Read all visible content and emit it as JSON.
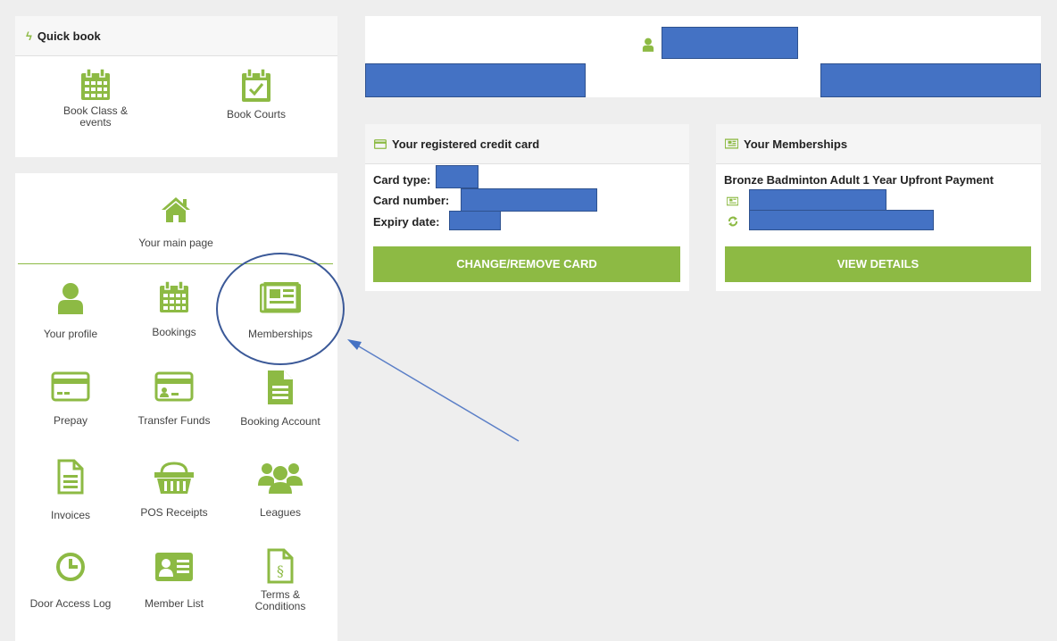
{
  "colors": {
    "accent": "#8dba44",
    "redaction": "#4472c4",
    "annotation": "#3b5998"
  },
  "quick_book": {
    "title": "Quick book",
    "items": [
      {
        "label": "Book Class & events",
        "icon": "calendar-icon"
      },
      {
        "label": "Book Courts",
        "icon": "calendar-check-icon"
      }
    ]
  },
  "nav": {
    "main": {
      "label": "Your main page",
      "icon": "home-icon"
    },
    "items": [
      {
        "label": "Your profile",
        "icon": "user-icon"
      },
      {
        "label": "Bookings",
        "icon": "calendar-icon"
      },
      {
        "label": "Memberships",
        "icon": "newspaper-icon"
      },
      {
        "label": "Prepay",
        "icon": "credit-card-icon"
      },
      {
        "label": "Transfer Funds",
        "icon": "card-transfer-icon"
      },
      {
        "label": "Booking Account",
        "icon": "document-icon"
      },
      {
        "label": "Invoices",
        "icon": "invoice-icon"
      },
      {
        "label": "POS Receipts",
        "icon": "basket-icon"
      },
      {
        "label": "Leagues",
        "icon": "users-icon"
      },
      {
        "label": "Door Access Log",
        "icon": "clock-icon"
      },
      {
        "label": "Member List",
        "icon": "id-card-icon"
      },
      {
        "label": "Terms & Conditions",
        "icon": "legal-document-icon"
      }
    ]
  },
  "credit_card": {
    "title": "Your registered credit card",
    "card_type_label": "Card type:",
    "card_number_label": "Card number:",
    "expiry_label": "Expiry date:",
    "button": "CHANGE/REMOVE CARD"
  },
  "memberships": {
    "title": "Your Memberships",
    "membership_name": "Bronze Badminton Adult 1 Year Upfront Payment",
    "button": "VIEW DETAILS"
  }
}
